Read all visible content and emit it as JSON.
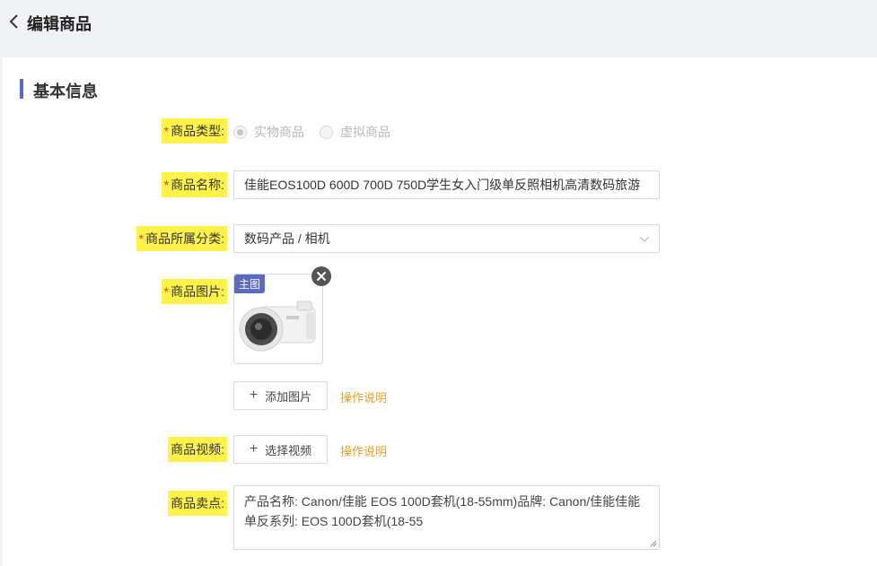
{
  "header": {
    "title": "编辑商品"
  },
  "section": {
    "title": "基本信息"
  },
  "form": {
    "required_mark": "*",
    "product_type": {
      "label": "商品类型:",
      "options": [
        "实物商品",
        "虚拟商品"
      ],
      "selected": "实物商品"
    },
    "product_name": {
      "label": "商品名称:",
      "value": "佳能EOS100D 600D 700D 750D学生女入门级单反照相机高清数码旅游"
    },
    "category": {
      "label": "商品所属分类:",
      "value": "数码产品 / 相机"
    },
    "images": {
      "label": "商品图片:",
      "main_tag": "主图",
      "add_button": "添加图片",
      "help_link": "操作说明"
    },
    "video": {
      "label": "商品视频:",
      "select_button": "选择视频",
      "help_link": "操作说明"
    },
    "selling_points": {
      "label": "商品卖点:",
      "value": "产品名称: Canon/佳能 EOS 100D套机(18-55mm)品牌: Canon/佳能佳能单反系列: EOS 100D套机(18-55"
    }
  },
  "colors": {
    "accent": "#5b6ac2",
    "highlight": "#fff34a",
    "required": "#e8402f",
    "link": "#f0a020"
  }
}
